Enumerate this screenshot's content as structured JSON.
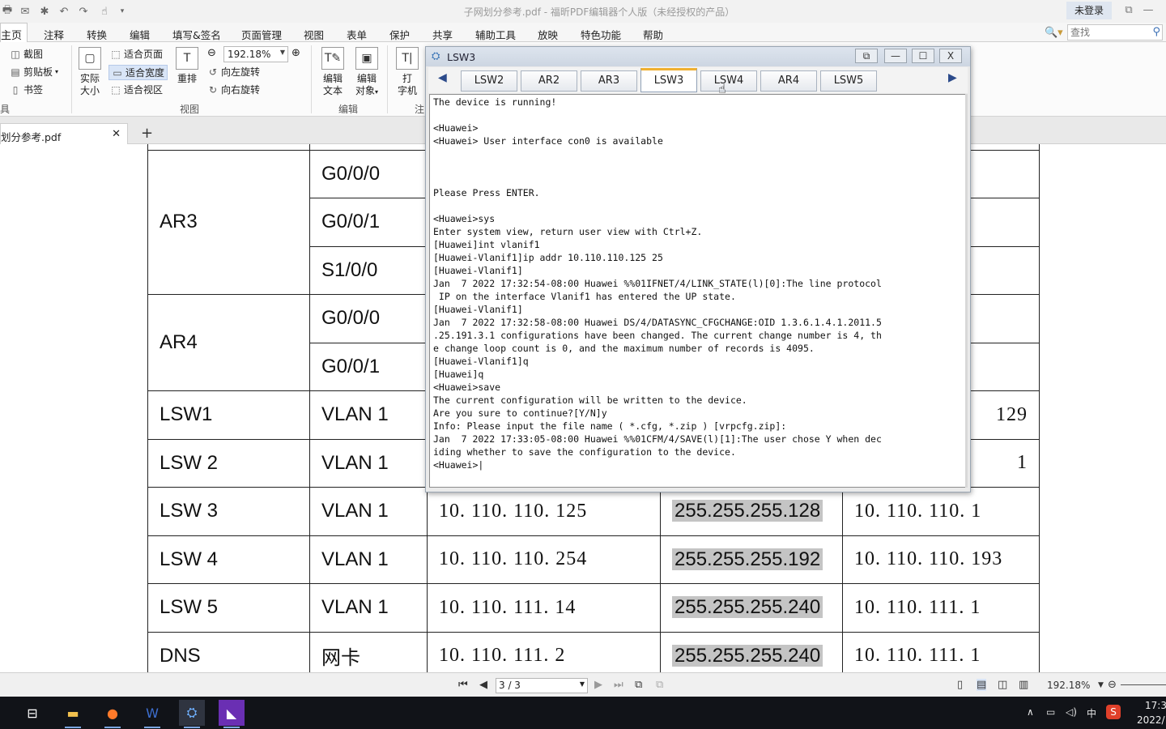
{
  "app": {
    "title": "子网划分参考.pdf - 福昕PDF编辑器个人版（未经授权的产品）",
    "login_label": "未登录",
    "window_controls": [
      "⧉",
      "—",
      "☐",
      "✕"
    ]
  },
  "menu": {
    "items": [
      "主页",
      "注释",
      "转换",
      "编辑",
      "填写&签名",
      "页面管理",
      "视图",
      "表单",
      "保护",
      "共享",
      "辅助工具",
      "放映",
      "特色功能",
      "帮助"
    ],
    "search_placeholder": "查找"
  },
  "ribbon": {
    "tools": {
      "screenshot": "截图",
      "clipboard": "剪贴板",
      "bookmark": "书签",
      "group_label": "具"
    },
    "view": {
      "actual_size_1": "实际",
      "actual_size_2": "大小",
      "fit_page": "适合页面",
      "fit_width": "适合宽度",
      "fit_view": "适合视区",
      "reflow": "重排",
      "zoom_value": "192.18%",
      "rotate_left": "向左旋转",
      "rotate_right": "向右旋转",
      "group_label": "视图"
    },
    "edit": {
      "edit_text_1": "编辑",
      "edit_text_2": "文本",
      "edit_object_1": "编辑",
      "edit_object_2": "对象",
      "group_label": "编辑"
    },
    "typewriter_1": "打",
    "typewriter_2": "字机",
    "comment_group": "注"
  },
  "doc_tab": {
    "name": "划分参考.pdf",
    "new_tab": "+"
  },
  "pdf_table": {
    "rows": [
      {
        "device": "AR3",
        "iface": "G0/0/0",
        "ip": "",
        "mask": "",
        "gw": ""
      },
      {
        "device": "",
        "iface": "G0/0/1",
        "ip": "",
        "mask": "",
        "gw": ""
      },
      {
        "device": "",
        "iface": "S1/0/0",
        "ip": "",
        "mask": "",
        "gw": ""
      },
      {
        "device": "AR4",
        "iface": "G0/0/0",
        "ip": "",
        "mask": "",
        "gw": ""
      },
      {
        "device": "",
        "iface": "G0/0/1",
        "ip": "",
        "mask": "",
        "gw": ""
      },
      {
        "device": "LSW1",
        "iface": "VLAN 1",
        "ip": "",
        "mask": "",
        "gw": "129"
      },
      {
        "device": "LSW 2",
        "iface": "VLAN 1",
        "ip": "",
        "mask": "",
        "gw": "1"
      },
      {
        "device": "LSW 3",
        "iface": "VLAN 1",
        "ip": "10. 110. 110. 125",
        "mask": "255.255.255.128",
        "gw": "10. 110. 110. 1"
      },
      {
        "device": "LSW 4",
        "iface": "VLAN 1",
        "ip": "10. 110. 110. 254",
        "mask": "255.255.255.192",
        "gw": "10. 110. 110. 193"
      },
      {
        "device": "LSW 5",
        "iface": "VLAN 1",
        "ip": "10. 110. 111. 14",
        "mask": "255.255.255.240",
        "gw": "10. 110. 111. 1"
      },
      {
        "device": "DNS",
        "iface": "网卡",
        "ip": "10. 110. 111. 2",
        "mask": "255.255.255.240",
        "gw": "10. 110. 111. 1"
      }
    ]
  },
  "console": {
    "title": "LSW3",
    "buttons": {
      "restore": "⧉",
      "minimize": "—",
      "maximize": "☐",
      "close": "X"
    },
    "tabs": [
      "LSW2",
      "AR2",
      "AR3",
      "LSW3",
      "LSW4",
      "AR4",
      "LSW5"
    ],
    "active_tab": "LSW3",
    "output": "The device is running!\n\n<Huawei>\n<Huawei> User interface con0 is available\n\n\n\nPlease Press ENTER.\n\n<Huawei>sys\nEnter system view, return user view with Ctrl+Z.\n[Huawei]int vlanif1\n[Huawei-Vlanif1]ip addr 10.110.110.125 25\n[Huawei-Vlanif1]\nJan  7 2022 17:32:54-08:00 Huawei %%01IFNET/4/LINK_STATE(l)[0]:The line protocol\n IP on the interface Vlanif1 has entered the UP state.\n[Huawei-Vlanif1]\nJan  7 2022 17:32:58-08:00 Huawei DS/4/DATASYNC_CFGCHANGE:OID 1.3.6.1.4.1.2011.5\n.25.191.3.1 configurations have been changed. The current change number is 4, th\ne change loop count is 0, and the maximum number of records is 4095.\n[Huawei-Vlanif1]q\n[Huawei]q\n<Huawei>save\nThe current configuration will be written to the device.\nAre you sure to continue?[Y/N]y\nInfo: Please input the file name ( *.cfg, *.zip ) [vrpcfg.zip]:\nJan  7 2022 17:33:05-08:00 Huawei %%01CFM/4/SAVE(l)[1]:The user chose Y when dec\niding whether to save the configuration to the device.\n<Huawei>|"
  },
  "statusbar": {
    "page": "3 / 3",
    "zoom": "192.18%"
  },
  "taskbar": {
    "tray": {
      "ime": "中",
      "time": "17:3",
      "date": "2022/"
    }
  },
  "colors": {
    "active_tab_accent": "#f0b030",
    "mask_highlight": "#c4c4c4",
    "taskbar": "#111318"
  }
}
